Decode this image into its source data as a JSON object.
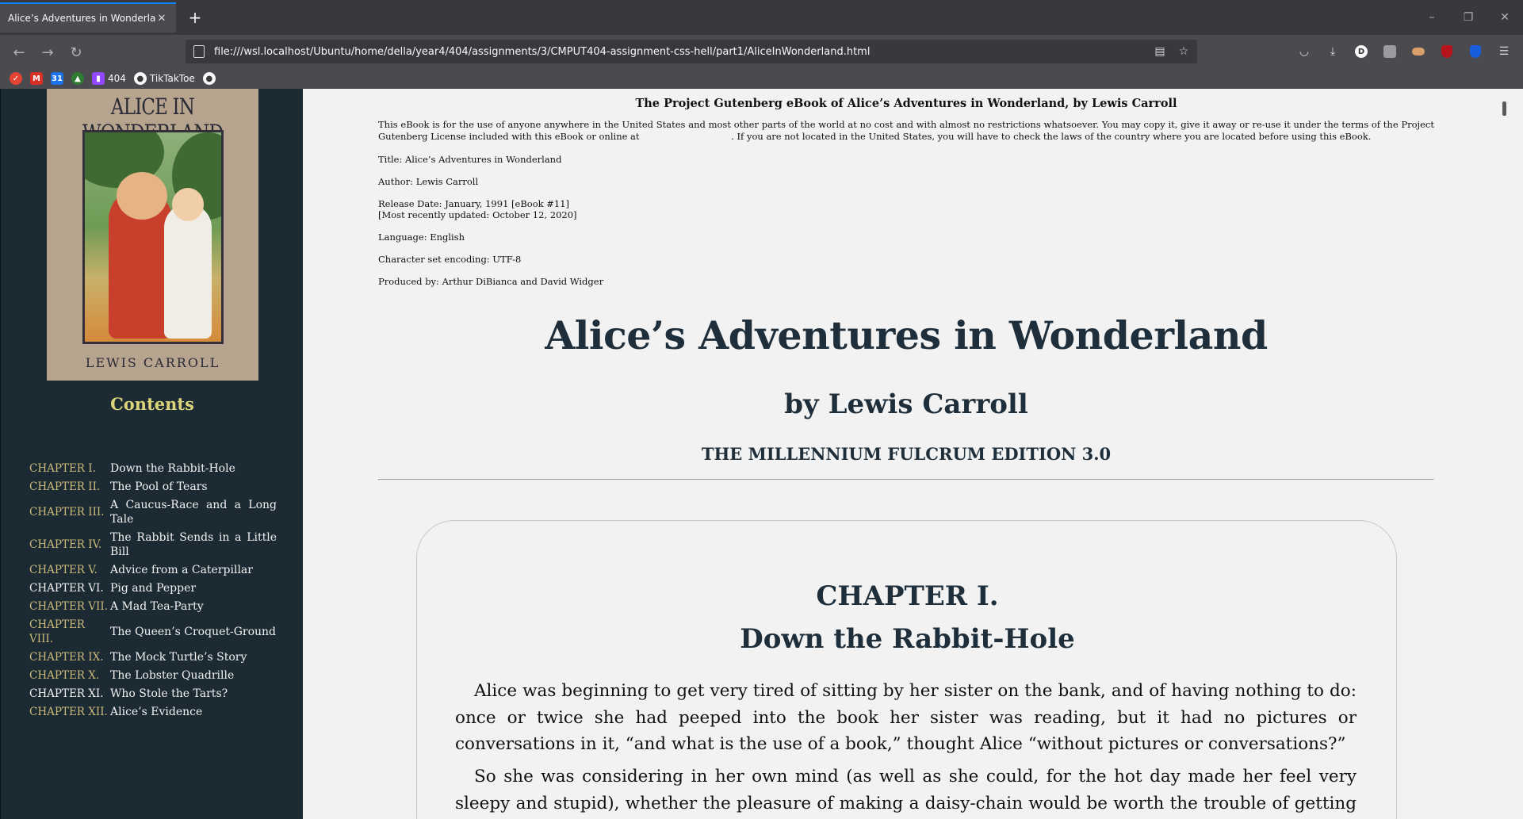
{
  "browser": {
    "tab_title": "Alice’s Adventures in Wonderland",
    "tab_close": "✕",
    "new_tab": "+",
    "url": "file:///wsl.localhost/Ubuntu/home/della/year4/404/assignments/3/CMPUT404-assignment-css-hell/part1/AliceInWonderland.html",
    "window_controls": [
      "–",
      "❐",
      "✕"
    ],
    "bookmarks": [
      {
        "label": "",
        "icon": "todoist-icon",
        "color": "#e44332"
      },
      {
        "label": "",
        "icon": "gmail-icon",
        "color": "#d93025"
      },
      {
        "label": "",
        "icon": "calendar-icon",
        "color": "#1a73e8"
      },
      {
        "label": "",
        "icon": "graduation-cap-icon",
        "color": "#2e7d32"
      },
      {
        "label": "404",
        "icon": "twitch-icon",
        "color": "#9146ff"
      },
      {
        "label": "TikTakToe",
        "icon": "github-icon",
        "color": "#f9f9fa"
      },
      {
        "label": "",
        "icon": "github-icon",
        "color": "#f9f9fa"
      }
    ]
  },
  "sidebar": {
    "cover": {
      "title": "ALICE IN WONDERLAND",
      "author": "LEWIS CARROLL"
    },
    "contents_title": "Contents",
    "toc": [
      {
        "chapter": "CHAPTER I.",
        "name": "Down the Rabbit-Hole",
        "bright": false
      },
      {
        "chapter": "CHAPTER II.",
        "name": "The Pool of Tears",
        "bright": false
      },
      {
        "chapter": "CHAPTER III.",
        "name": "A Caucus-Race and a Long Tale",
        "bright": false
      },
      {
        "chapter": "CHAPTER IV.",
        "name": "The Rabbit Sends in a Little Bill",
        "bright": false
      },
      {
        "chapter": "CHAPTER V.",
        "name": "Advice from a Caterpillar",
        "bright": false
      },
      {
        "chapter": "CHAPTER VI.",
        "name": "Pig and Pepper",
        "bright": true
      },
      {
        "chapter": "CHAPTER VII.",
        "name": "A Mad Tea-Party",
        "bright": false
      },
      {
        "chapter": "CHAPTER VIII.",
        "name": "The Queen’s Croquet-Ground",
        "bright": false
      },
      {
        "chapter": "CHAPTER IX.",
        "name": "The Mock Turtle’s Story",
        "bright": false
      },
      {
        "chapter": "CHAPTER X.",
        "name": "The Lobster Quadrille",
        "bright": false
      },
      {
        "chapter": "CHAPTER XI.",
        "name": "Who Stole the Tarts?",
        "bright": true
      },
      {
        "chapter": "CHAPTER XII.",
        "name": "Alice’s Evidence",
        "bright": false
      }
    ]
  },
  "content": {
    "header_title": "The Project Gutenberg eBook of Alice’s Adventures in Wonderland, by Lewis Carroll",
    "license_part1": "This eBook is for the use of anyone anywhere in the United States and most other parts of the world at no cost and with almost no restrictions whatsoever. You may copy it, give it away or re-use it under the terms of the Project Gutenberg License included with this eBook or online at",
    "license_part2": ". If you are not located in the United States, you will have to check the laws of the country where you are located before using this eBook.",
    "title_line": "Title: Alice’s Adventures in Wonderland",
    "author_line": "Author: Lewis Carroll",
    "release_line": "Release Date: January, 1991 [eBook #11]",
    "updated_line": "[Most recently updated: October 12, 2020]",
    "language_line": "Language: English",
    "encoding_line": "Character set encoding: UTF-8",
    "produced_line": "Produced by: Arthur DiBianca and David Widger",
    "main_title": "Alice’s Adventures in Wonderland",
    "byline": "by Lewis Carroll",
    "edition": "THE MILLENNIUM FULCRUM EDITION 3.0",
    "chapter_number": "CHAPTER I.",
    "chapter_name": "Down the Rabbit-Hole",
    "paragraph1": "Alice was beginning to get very tired of sitting by her sister on the bank, and of having nothing to do: once or twice she had peeped into the book her sister was reading, but it had no pictures or conversations in it, “and what is the use of a book,” thought Alice “without pictures or conversations?”",
    "paragraph2": "So she was considering in her own mind (as well as she could, for the hot day made her feel very sleepy and stupid), whether the pleasure of making a daisy-chain would be worth the trouble of getting up and picking the daisies, when suddenly a White Rabbit with pink eyes ran close by her."
  }
}
